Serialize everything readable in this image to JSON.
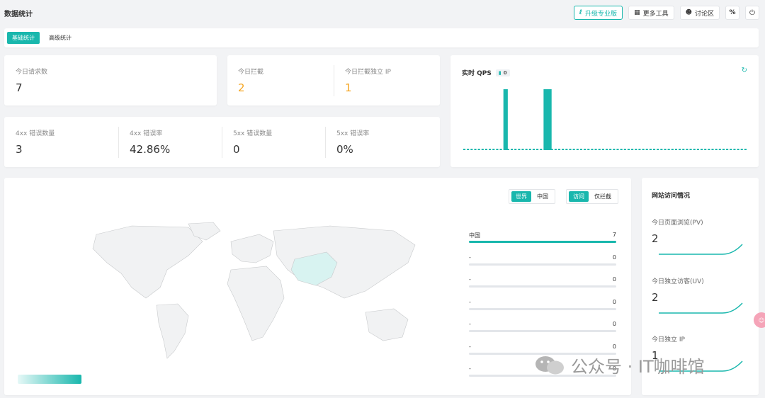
{
  "header": {
    "title": "数据统计",
    "upgrade_label": "升级专业版",
    "more_tools_label": "更多工具",
    "forum_label": "讨论区"
  },
  "tabs": [
    {
      "label": "基础统计",
      "active": true
    },
    {
      "label": "高级统计",
      "active": false
    }
  ],
  "stats_top": {
    "requests": {
      "label": "今日请求数",
      "value": "7"
    },
    "blocked": {
      "label": "今日拦截",
      "value": "2"
    },
    "blocked_ip": {
      "label": "今日拦截独立 IP",
      "value": "1"
    }
  },
  "stats_errors": [
    {
      "label": "4xx 错误数量",
      "value": "3"
    },
    {
      "label": "4xx 错误率",
      "value": "42.86%"
    },
    {
      "label": "5xx 错误数量",
      "value": "0"
    },
    {
      "label": "5xx 错误率",
      "value": "0%"
    }
  ],
  "qps": {
    "title": "实时 QPS",
    "current": "0",
    "accent": "#19b7ad",
    "chart_data": {
      "type": "bar",
      "values": [
        0,
        0,
        0,
        0,
        0,
        0,
        0,
        0,
        0,
        0,
        0,
        1,
        0,
        0,
        0,
        0,
        0,
        0,
        0,
        0,
        0,
        0,
        1,
        1,
        0,
        0,
        0,
        0,
        0,
        0,
        0,
        0,
        0,
        0,
        0,
        0,
        0,
        0,
        0,
        0,
        0,
        0,
        0,
        0,
        0,
        0,
        0,
        0,
        0,
        0,
        0,
        0,
        0,
        0,
        0,
        0,
        0,
        0,
        0,
        0,
        0,
        0,
        0,
        0,
        0,
        0,
        0,
        0,
        0,
        0,
        0,
        0,
        0,
        0,
        0,
        0,
        0,
        0
      ],
      "title": "",
      "xlabel": "",
      "ylabel": ""
    }
  },
  "map": {
    "region_toggle": {
      "options": [
        "世界",
        "中国"
      ],
      "selected": "世界"
    },
    "mode_toggle": {
      "options": [
        "访问",
        "仅拦截"
      ],
      "selected": "访问"
    },
    "countries": [
      {
        "name": "中国",
        "count": "7",
        "ratio": 1.0
      },
      {
        "name": "-",
        "count": "0",
        "ratio": 0
      },
      {
        "name": "-",
        "count": "0",
        "ratio": 0
      },
      {
        "name": "-",
        "count": "0",
        "ratio": 0
      },
      {
        "name": "-",
        "count": "0",
        "ratio": 0
      },
      {
        "name": "-",
        "count": "0",
        "ratio": 0
      },
      {
        "name": "-",
        "count": "0",
        "ratio": 0
      }
    ]
  },
  "site": {
    "title": "网站访问情况",
    "items": [
      {
        "label": "今日页面浏览(PV)",
        "value": "2"
      },
      {
        "label": "今日独立访客(UV)",
        "value": "2"
      },
      {
        "label": "今日独立 IP",
        "value": "1"
      }
    ]
  },
  "watermark": {
    "text": "公众号 · IT咖啡馆"
  }
}
